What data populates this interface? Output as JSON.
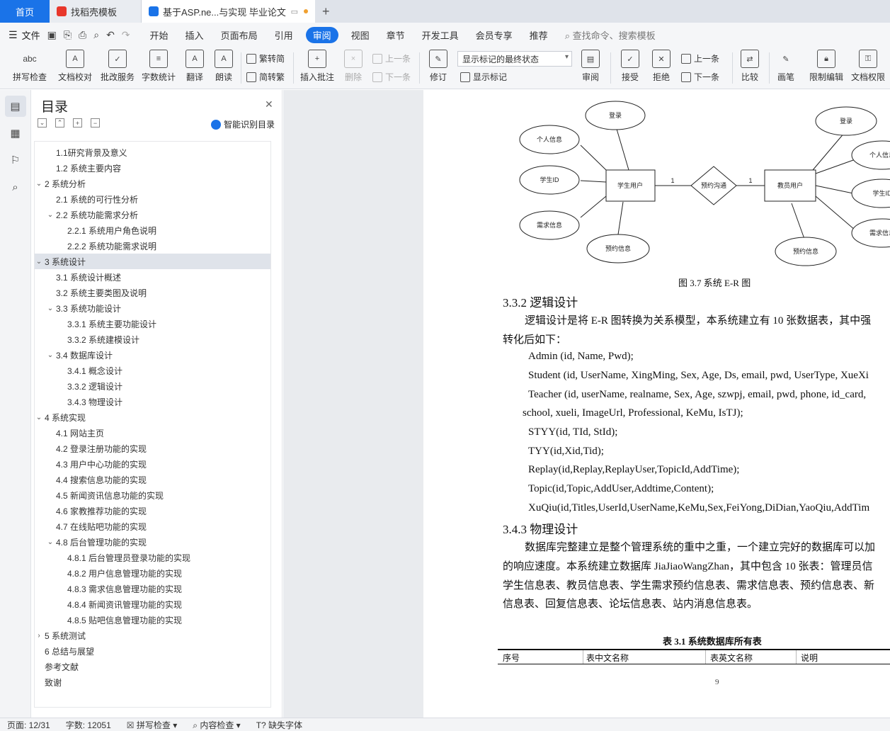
{
  "tabs": {
    "home": "首页",
    "tab1": "找稻壳模板",
    "tab2": "基于ASP.ne...与实现 毕业论文",
    "add": "+"
  },
  "menu": {
    "file": "文件",
    "items": [
      "开始",
      "插入",
      "页面布局",
      "引用",
      "审阅",
      "视图",
      "章节",
      "开发工具",
      "会员专享",
      "推荐"
    ],
    "active": "审阅",
    "search": "查找命令、搜索模板"
  },
  "ribbon": {
    "spellcheck": "拼写检查",
    "doc_check": "文档校对",
    "batch": "批改服务",
    "word_count": "字数统计",
    "translate": "翻译",
    "read": "朗读",
    "trad": "繁转简",
    "simp": "简转繁",
    "insert_comment": "插入批注",
    "delete": "删除",
    "prev": "上一条",
    "next": "下一条",
    "revise": "修订",
    "markup_select": "显示标记的最终状态",
    "show_markup": "显示标记",
    "review": "审阅",
    "accept": "接受",
    "reject": "拒绝",
    "prev2": "上一条",
    "next2": "下一条",
    "compare": "比较",
    "pen": "画笔",
    "restrict": "限制编辑",
    "perm": "文档权限"
  },
  "toc": {
    "title": "目录",
    "smart": "智能识别目录",
    "items": [
      {
        "text": "1.1研究背景及意义",
        "level": 2,
        "caret": ""
      },
      {
        "text": "1.2 系统主要内容",
        "level": 2,
        "caret": ""
      },
      {
        "text": "2 系统分析",
        "level": 1,
        "caret": "v"
      },
      {
        "text": "2.1 系统的可行性分析",
        "level": 2,
        "caret": ""
      },
      {
        "text": "2.2 系统功能需求分析",
        "level": 2,
        "caret": "v"
      },
      {
        "text": "2.2.1 系统用户角色说明",
        "level": 3,
        "caret": ""
      },
      {
        "text": "2.2.2 系统功能需求说明",
        "level": 3,
        "caret": ""
      },
      {
        "text": "3 系统设计",
        "level": 1,
        "caret": "v",
        "selected": true
      },
      {
        "text": "3.1 系统设计概述",
        "level": 2,
        "caret": ""
      },
      {
        "text": "3.2  系统主要类图及说明",
        "level": 2,
        "caret": ""
      },
      {
        "text": "3.3 系统功能设计",
        "level": 2,
        "caret": "v"
      },
      {
        "text": "3.3.1  系统主要功能设计",
        "level": 3,
        "caret": ""
      },
      {
        "text": "3.3.2  系统建模设计",
        "level": 3,
        "caret": ""
      },
      {
        "text": "3.4 数据库设计",
        "level": 2,
        "caret": "v"
      },
      {
        "text": "3.4.1  概念设计",
        "level": 3,
        "caret": ""
      },
      {
        "text": "3.3.2  逻辑设计",
        "level": 3,
        "caret": ""
      },
      {
        "text": "3.4.3  物理设计",
        "level": 3,
        "caret": ""
      },
      {
        "text": "4 系统实现",
        "level": 1,
        "caret": "v"
      },
      {
        "text": "4.1 网站主页",
        "level": 2,
        "caret": ""
      },
      {
        "text": "4.2  登录注册功能的实现",
        "level": 2,
        "caret": ""
      },
      {
        "text": "4.3 用户中心功能的实现",
        "level": 2,
        "caret": ""
      },
      {
        "text": "4.4 搜索信息功能的实现",
        "level": 2,
        "caret": ""
      },
      {
        "text": "4.5 新闻资讯信息功能的实现",
        "level": 2,
        "caret": ""
      },
      {
        "text": "4.6 家教推荐功能的实现",
        "level": 2,
        "caret": ""
      },
      {
        "text": "4.7 在线贴吧功能的实现",
        "level": 2,
        "caret": ""
      },
      {
        "text": "4.8 后台管理功能的实现",
        "level": 2,
        "caret": "v"
      },
      {
        "text": "4.8.1  后台管理员登录功能的实现",
        "level": 3,
        "caret": ""
      },
      {
        "text": "4.8.2  用户信息管理功能的实现",
        "level": 3,
        "caret": ""
      },
      {
        "text": "4.8.3  需求信息管理功能的实现",
        "level": 3,
        "caret": ""
      },
      {
        "text": "4.8.4  新闻资讯管理功能的实现",
        "level": 3,
        "caret": ""
      },
      {
        "text": "4.8.5  贴吧信息管理功能的实现",
        "level": 3,
        "caret": ""
      },
      {
        "text": "5 系统测试",
        "level": 1,
        "caret": ">"
      },
      {
        "text": "6 总结与展望",
        "level": 1,
        "caret": ""
      },
      {
        "text": "参考文献",
        "level": 1,
        "caret": ""
      },
      {
        "text": "致谢",
        "level": 1,
        "caret": ""
      }
    ]
  },
  "erd": {
    "left_entity": "学生用户",
    "relation": "预约沟通",
    "right_entity": "教员用户",
    "card_left": "1",
    "card_right": "1",
    "left_attrs": [
      "登录",
      "个人信息",
      "学生ID",
      "需求信息",
      "预约信息"
    ],
    "right_attrs": [
      "登录",
      "个人信息",
      "学生ID",
      "需求信息",
      "预约信息"
    ],
    "caption": "图 3.7  系统 E-R 图"
  },
  "doc": {
    "h332": "3.3.2  逻辑设计",
    "p1a": "逻辑设计是将 E-R 图转换为关系模型，本系统建立有 10 张数据表，其中强",
    "p1b": "转化后如下：",
    "rels": [
      "Admin (id, Name, Pwd);",
      "Student (id, UserName, XingMing, Sex, Age, Ds, email, pwd, UserType, XueXi",
      "Teacher (id, userName, realname, Sex, Age, szwpj, email, pwd, phone, id_card,",
      "school, xueli, ImageUrl, Professional, KeMu, IsTJ);",
      "STYY(id, TId, StId);",
      "TYY(id,Xid,Tid);",
      "Replay(id,Replay,ReplayUser,TopicId,AddTime);",
      "Topic(id,Topic,AddUser,Addtime,Content);",
      "XuQiu(id,Titles,UserId,UserName,KeMu,Sex,FeiYong,DiDian,YaoQiu,AddTim"
    ],
    "h343": "3.4.3  物理设计",
    "p2": [
      "数据库完整建立是整个管理系统的重中之重，一个建立完好的数据库可以加",
      "的响应速度。本系统建立数据库 JiaJiaoWangZhan，其中包含 10 张表：管理员信",
      "学生信息表、教员信息表、学生需求预约信息表、需求信息表、预约信息表、新",
      "信息表、回复信息表、论坛信息表、站内消息信息表。"
    ],
    "table_caption": "表 3.1 系统数据库所有表",
    "table_headers": [
      "序号",
      "表中文名称",
      "表英文名称",
      "说明"
    ],
    "page_number": "9"
  },
  "status": {
    "page": "页面: 12/31",
    "words": "字数: 12051",
    "spell": "拼写检查",
    "content": "内容检查",
    "missing_font": "缺失字体"
  }
}
